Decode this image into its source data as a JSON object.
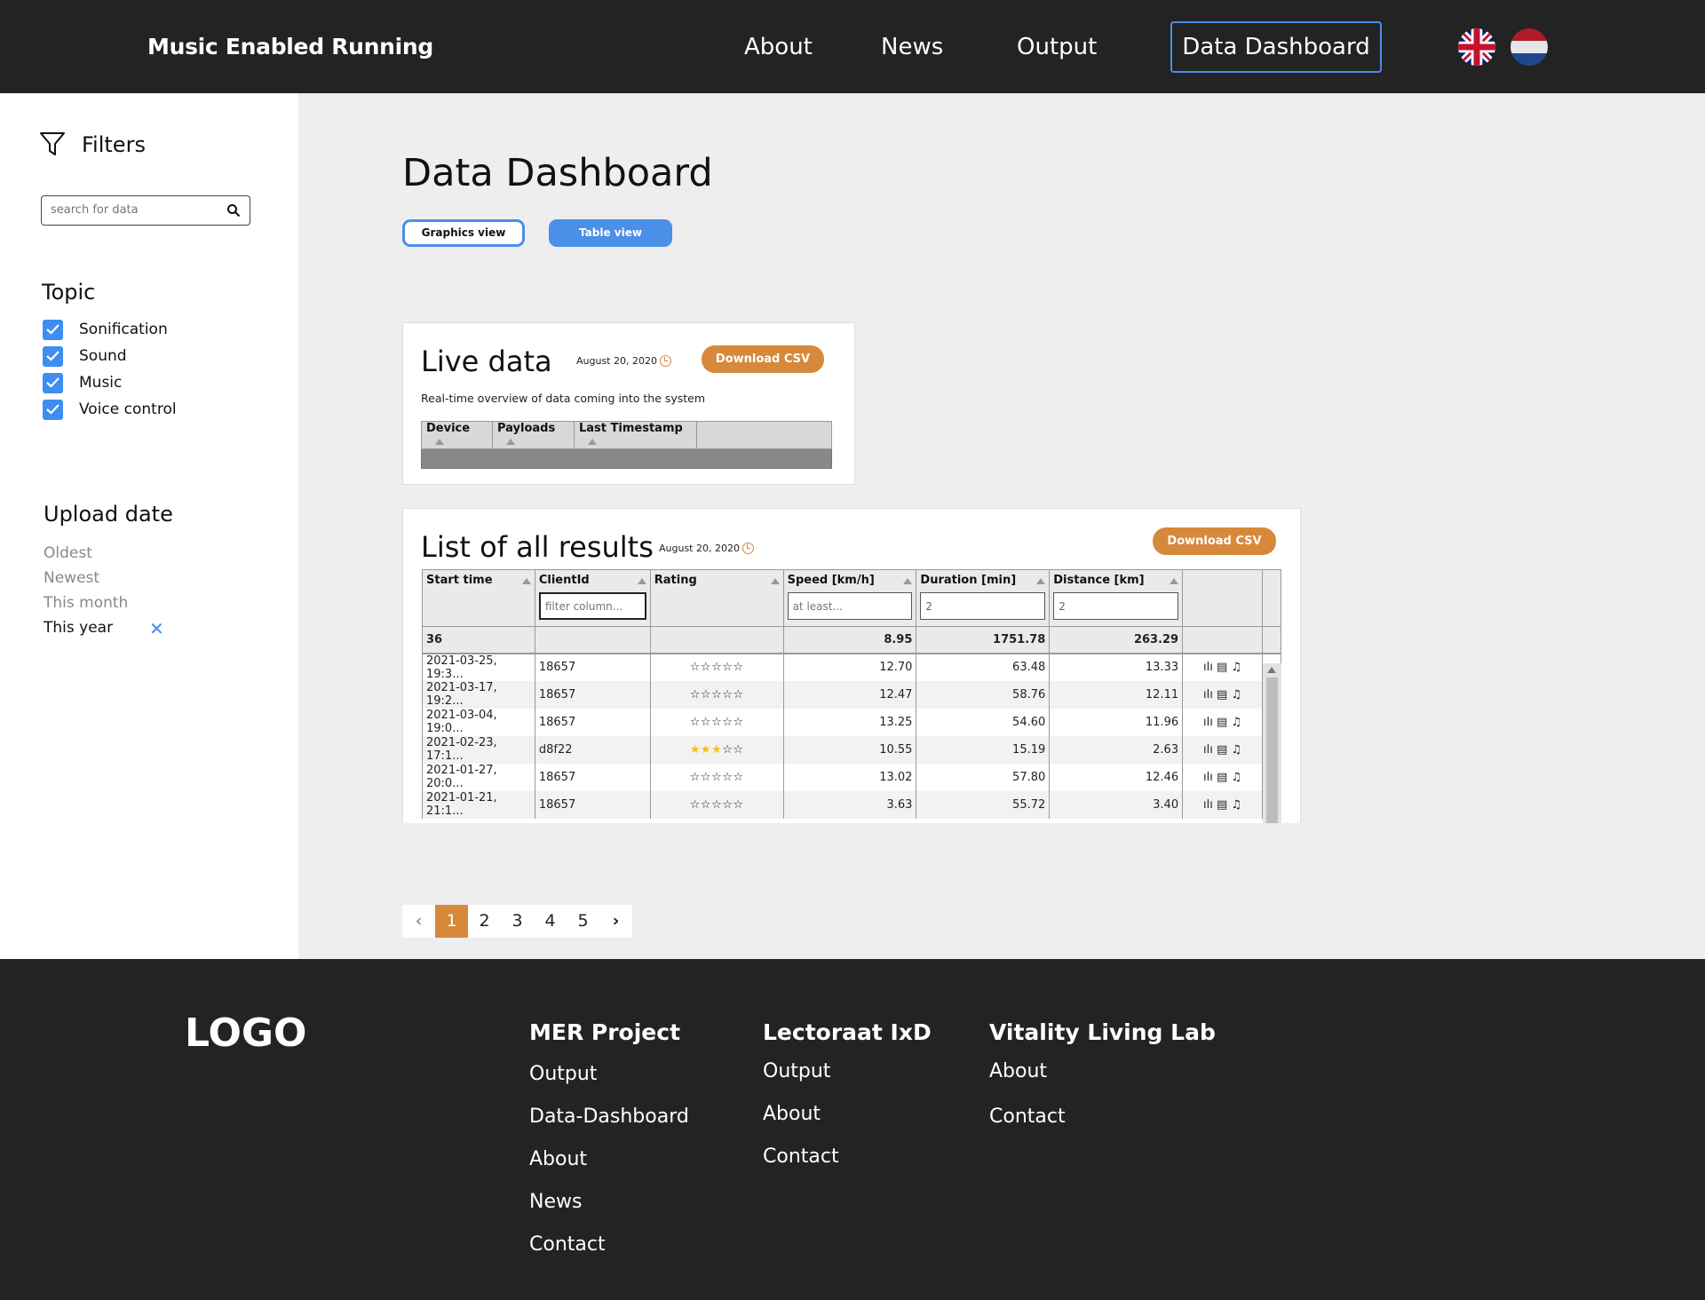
{
  "header": {
    "brand": "Music Enabled Running",
    "nav": [
      "About",
      "News",
      "Output"
    ],
    "nav_current": "Data Dashboard"
  },
  "sidebar": {
    "filters_title": "Filters",
    "search_placeholder": "search for data",
    "topic_title": "Topic",
    "topics": [
      "Sonification",
      "Sound",
      "Music",
      "Voice control"
    ],
    "upload_title": "Upload date",
    "date_options": [
      "Oldest",
      "Newest",
      "This month",
      "This year"
    ],
    "selected_date": "This year"
  },
  "main": {
    "title": "Data Dashboard",
    "graphics_btn": "Graphics view",
    "table_btn": "Table view",
    "live": {
      "title": "Live data",
      "date": "August 20, 2020",
      "csv": "Download CSV",
      "subtitle": "Real-time overview of data coming into the system",
      "columns": [
        "Device",
        "Payloads",
        "Last Timestamp"
      ]
    },
    "results": {
      "title": "List of all results",
      "date": "August 20, 2020",
      "csv": "Download CSV",
      "columns": [
        "Start time",
        "ClientId",
        "Rating",
        "Speed [km/h]",
        "Duration [min]",
        "Distance [km]"
      ],
      "filters": [
        "",
        "filter column...",
        "",
        "at least...",
        "2",
        "2"
      ],
      "totals": [
        "36",
        "",
        "",
        "8.95",
        "1751.78",
        "263.29"
      ],
      "rows": [
        {
          "start": "2021-03-25, 19:3...",
          "client": "18657",
          "rating": 0,
          "speed": "12.70",
          "duration": "63.48",
          "distance": "13.33"
        },
        {
          "start": "2021-03-17, 19:2...",
          "client": "18657",
          "rating": 0,
          "speed": "12.47",
          "duration": "58.76",
          "distance": "12.11"
        },
        {
          "start": "2021-03-04, 19:0...",
          "client": "18657",
          "rating": 0,
          "speed": "13.25",
          "duration": "54.60",
          "distance": "11.96"
        },
        {
          "start": "2021-02-23, 17:1...",
          "client": "d8f22",
          "rating": 3,
          "speed": "10.55",
          "duration": "15.19",
          "distance": "2.63"
        },
        {
          "start": "2021-01-27, 20:0...",
          "client": "18657",
          "rating": 0,
          "speed": "13.02",
          "duration": "57.80",
          "distance": "12.46"
        },
        {
          "start": "2021-01-21, 21:1...",
          "client": "18657",
          "rating": 0,
          "speed": "3.63",
          "duration": "55.72",
          "distance": "3.40"
        }
      ]
    },
    "pager": {
      "pages": [
        "1",
        "2",
        "3",
        "4",
        "5"
      ],
      "current": "1"
    }
  },
  "footer": {
    "logo": "LOGO",
    "cols": [
      {
        "title": "MER Project",
        "links": [
          "Output",
          "Data-Dashboard",
          "About",
          "News",
          "Contact"
        ]
      },
      {
        "title": "Lectoraat IxD",
        "links": [
          "Output",
          "About",
          "Contact"
        ]
      },
      {
        "title": "Vitality Living Lab",
        "links": [
          "About",
          "Contact"
        ]
      }
    ]
  },
  "colors": {
    "accent": "#4a8fe8",
    "csv": "#d6893b",
    "dark": "#232323",
    "panel": "#eeeeee"
  }
}
